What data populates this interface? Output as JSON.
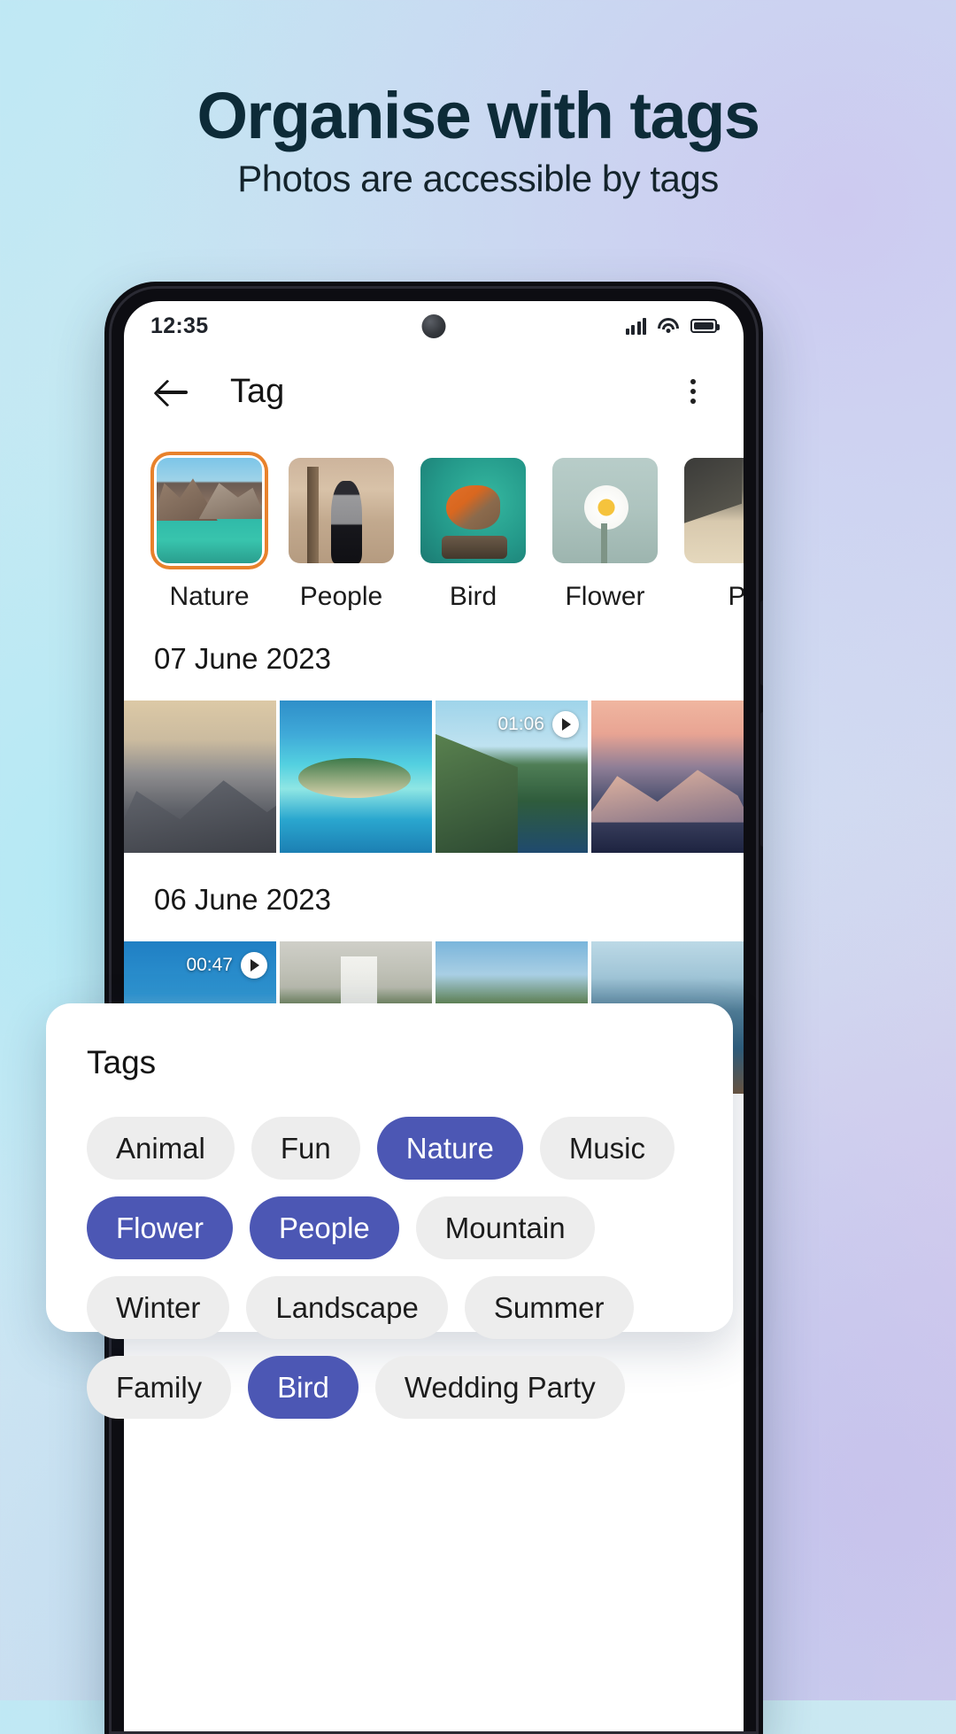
{
  "promo": {
    "headline": "Organise with tags",
    "subheadline": "Photos are accessible by tags"
  },
  "colors": {
    "accent_selected_chip": "#4c57b4",
    "chip_unselected": "#ededed",
    "tag_selection_border": "#e8822c",
    "headline": "#0d2b38"
  },
  "phone": {
    "status_bar": {
      "time": "12:35",
      "icons": [
        "signal-bars-icon",
        "wifi-icon",
        "battery-icon"
      ]
    },
    "app_bar": {
      "back_icon": "back-arrow-icon",
      "title": "Tag",
      "overflow_icon": "kebab-menu-icon"
    },
    "tag_carousel": [
      {
        "label": "Nature",
        "selected": true,
        "art": "a-nature"
      },
      {
        "label": "People",
        "selected": false,
        "art": "a-people"
      },
      {
        "label": "Bird",
        "selected": false,
        "art": "a-bird"
      },
      {
        "label": "Flower",
        "selected": false,
        "art": "a-flower"
      },
      {
        "label": "P",
        "selected": false,
        "art": "a-partial"
      }
    ],
    "sections": [
      {
        "date": "07 June 2023",
        "items": [
          {
            "art": "p1",
            "video": false,
            "duration": ""
          },
          {
            "art": "p2",
            "video": false,
            "duration": ""
          },
          {
            "art": "p3",
            "video": true,
            "duration": "01:06"
          },
          {
            "art": "p4",
            "video": false,
            "duration": ""
          }
        ]
      },
      {
        "date": "06 June 2023",
        "items": [
          {
            "art": "p5",
            "video": true,
            "duration": "00:47"
          },
          {
            "art": "p6",
            "video": false,
            "duration": ""
          },
          {
            "art": "p7",
            "video": false,
            "duration": ""
          },
          {
            "art": "p8",
            "video": false,
            "duration": ""
          }
        ]
      }
    ],
    "partial_row": [
      {
        "art": "p9"
      },
      {
        "art": "p10"
      },
      {
        "art": "p11"
      }
    ]
  },
  "tags_sheet": {
    "title": "Tags",
    "chips": [
      {
        "label": "Animal",
        "selected": false
      },
      {
        "label": "Fun",
        "selected": false
      },
      {
        "label": "Nature",
        "selected": true
      },
      {
        "label": "Music",
        "selected": false
      },
      {
        "label": "Flower",
        "selected": true
      },
      {
        "label": "People",
        "selected": true
      },
      {
        "label": "Mountain",
        "selected": false
      },
      {
        "label": "Winter",
        "selected": false
      },
      {
        "label": "Landscape",
        "selected": false
      },
      {
        "label": "Summer",
        "selected": false
      },
      {
        "label": "Family",
        "selected": false
      },
      {
        "label": "Bird",
        "selected": true
      },
      {
        "label": "Wedding Party",
        "selected": false
      }
    ]
  }
}
